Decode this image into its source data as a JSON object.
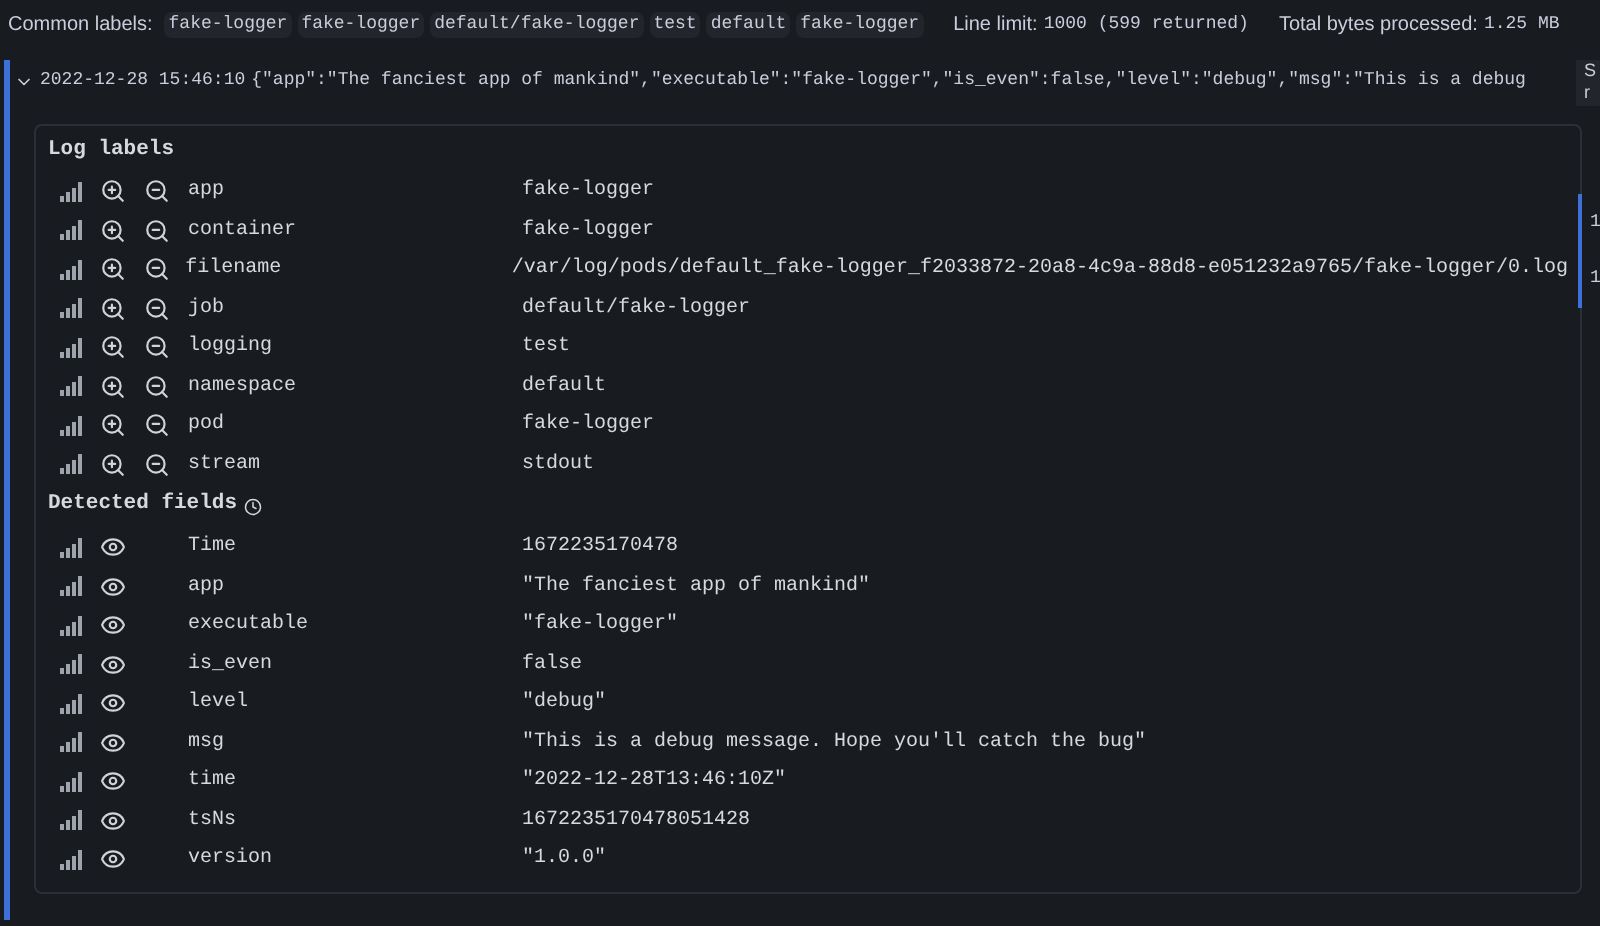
{
  "header": {
    "common_labels_title": "Common labels:",
    "common_labels": [
      "fake-logger",
      "fake-logger",
      "default/fake-logger",
      "test",
      "default",
      "fake-logger"
    ],
    "line_limit_label": "Line limit:",
    "line_limit_value": "1000 (599 returned)",
    "bytes_label": "Total bytes processed:",
    "bytes_value": "1.25 MB"
  },
  "log_row": {
    "expanded": true,
    "timestamp": "2022-12-28 15:46:10",
    "message": "{\"app\":\"The fanciest app of mankind\",\"executable\":\"fake-logger\",\"is_even\":false,\"level\":\"debug\",\"msg\":\"This is a debug"
  },
  "details": {
    "log_labels_title": "Log labels",
    "log_labels": [
      {
        "name": "app",
        "value": "fake-logger"
      },
      {
        "name": "container",
        "value": "fake-logger"
      },
      {
        "name": "filename",
        "value": "/var/log/pods/default_fake-logger_f2033872-20a8-4c9a-88d8-e051232a9765/fake-logger/0.log"
      },
      {
        "name": "job",
        "value": "default/fake-logger"
      },
      {
        "name": "logging",
        "value": "test"
      },
      {
        "name": "namespace",
        "value": "default"
      },
      {
        "name": "pod",
        "value": "fake-logger"
      },
      {
        "name": "stream",
        "value": "stdout"
      }
    ],
    "detected_fields_title": "Detected fields",
    "detected_fields": [
      {
        "name": "Time",
        "value": "1672235170478"
      },
      {
        "name": "app",
        "value": "\"The fanciest app of mankind\""
      },
      {
        "name": "executable",
        "value": "\"fake-logger\""
      },
      {
        "name": "is_even",
        "value": "false"
      },
      {
        "name": "level",
        "value": "\"debug\""
      },
      {
        "name": "msg",
        "value": "\"This is a debug message. Hope you'll catch the bug\""
      },
      {
        "name": "time",
        "value": "\"2022-12-28T13:46:10Z\""
      },
      {
        "name": "tsNs",
        "value": "1672235170478051428"
      },
      {
        "name": "version",
        "value": "\"1.0.0\""
      }
    ]
  },
  "side_tooltip": [
    "S",
    "r"
  ],
  "side_marks": [
    "1",
    "1"
  ]
}
